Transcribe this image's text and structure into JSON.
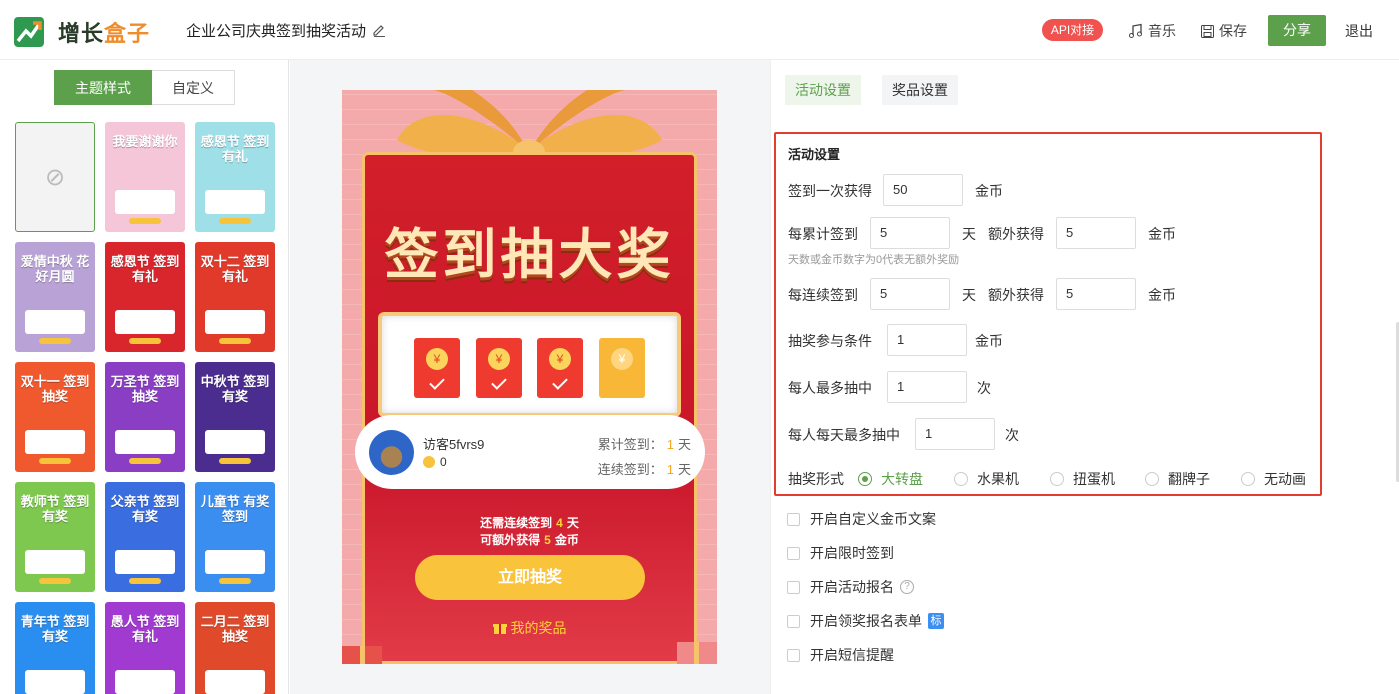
{
  "header": {
    "logo_text_a": "增长",
    "logo_text_b": "盒子",
    "activity_title": "企业公司庆典签到抽奖活动",
    "api_label": "API对接",
    "music_label": "音乐",
    "save_label": "保存",
    "share_label": "分享",
    "exit_label": "退出"
  },
  "left": {
    "tabs": [
      "主题样式",
      "自定义"
    ],
    "none_symbol": "⊘",
    "themes": [
      {
        "title": "我要谢谢你",
        "color": "#f5c6d8"
      },
      {
        "title": "感恩节 签到有礼",
        "color": "#9fe0e8"
      },
      {
        "title": "爱情中秋 花好月圆",
        "color": "#b9a2d6"
      },
      {
        "title": "感恩节 签到有礼",
        "color": "#d8262c"
      },
      {
        "title": "双十二 签到有礼",
        "color": "#e23a2a"
      },
      {
        "title": "双十一 签到抽奖",
        "color": "#f0582e"
      },
      {
        "title": "万圣节 签到抽奖",
        "color": "#8a3ec4"
      },
      {
        "title": "中秋节 签到有奖",
        "color": "#4a2d8e"
      },
      {
        "title": "教师节 签到有奖",
        "color": "#7ec850"
      },
      {
        "title": "父亲节 签到有奖",
        "color": "#3a6ee0"
      },
      {
        "title": "儿童节 有奖签到",
        "color": "#3a8ef0"
      },
      {
        "title": "青年节 签到有奖",
        "color": "#2a8ef0"
      },
      {
        "title": "愚人节 签到有礼",
        "color": "#a03ad0"
      },
      {
        "title": "二月二 签到抽奖",
        "color": "#e04a2a"
      }
    ]
  },
  "preview": {
    "big_title": "签到抽大奖",
    "coin_symbol": "¥",
    "packets": [
      true,
      true,
      true,
      false
    ],
    "user_name": "访客5fvrs9",
    "coins": "0",
    "cumulative_label": "累计签到：",
    "cumulative_value": "1",
    "consecutive_label": "连续签到：",
    "consecutive_value": "1",
    "day_unit": "天",
    "tip1_pre": "还需连续签到",
    "tip1_num": "4",
    "tip1_post": "天",
    "tip2_pre": "可额外获得",
    "tip2_num": "5",
    "tip2_post": "金币",
    "draw_button": "立即抽奖",
    "my_prize": "我的奖品"
  },
  "right": {
    "tabs": [
      "活动设置",
      "奖品设置"
    ],
    "section_title": "活动设置",
    "sign_once_label": "签到一次获得",
    "sign_once_value": "50",
    "coin_unit": "金币",
    "cumulative_label": "每累计签到",
    "cumulative_days": "5",
    "day_unit": "天",
    "extra_label": "额外获得",
    "cumulative_extra": "5",
    "hint": "天数或金币数字为0代表无额外奖励",
    "consecutive_label": "每连续签到",
    "consecutive_days": "5",
    "consecutive_extra": "5",
    "condition_label": "抽奖参与条件",
    "condition_value": "1",
    "max_win_label": "每人最多抽中",
    "max_win_value": "1",
    "times_unit": "次",
    "daily_max_label": "每人每天最多抽中",
    "daily_max_value": "1",
    "form_label": "抽奖形式",
    "forms": [
      "大转盘",
      "水果机",
      "扭蛋机",
      "翻牌子",
      "无动画"
    ],
    "selected_form": "大转盘",
    "checkboxes": [
      "开启自定义金币文案",
      "开启限时签到",
      "开启活动报名",
      "开启领奖报名表单",
      "开启短信提醒"
    ],
    "tag_label": "标",
    "question_mark": "?"
  }
}
